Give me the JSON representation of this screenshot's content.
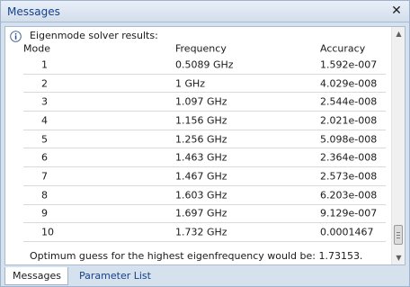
{
  "window": {
    "title": "Messages",
    "close_glyph": "✕"
  },
  "content": {
    "info_icon": "info-icon",
    "header": "Eigenmode solver results:",
    "columns": [
      "Mode",
      "Frequency",
      "Accuracy"
    ],
    "rows": [
      {
        "mode": "1",
        "frequency": "0.5089 GHz",
        "accuracy": "1.592e-007"
      },
      {
        "mode": "2",
        "frequency": "1 GHz",
        "accuracy": "4.029e-008"
      },
      {
        "mode": "3",
        "frequency": "1.097 GHz",
        "accuracy": "2.544e-008"
      },
      {
        "mode": "4",
        "frequency": "1.156 GHz",
        "accuracy": "2.021e-008"
      },
      {
        "mode": "5",
        "frequency": "1.256 GHz",
        "accuracy": "5.098e-008"
      },
      {
        "mode": "6",
        "frequency": "1.463 GHz",
        "accuracy": "2.364e-008"
      },
      {
        "mode": "7",
        "frequency": "1.467 GHz",
        "accuracy": "2.573e-008"
      },
      {
        "mode": "8",
        "frequency": "1.603 GHz",
        "accuracy": "6.203e-008"
      },
      {
        "mode": "9",
        "frequency": "1.697 GHz",
        "accuracy": "9.129e-007"
      },
      {
        "mode": "10",
        "frequency": "1.732 GHz",
        "accuracy": "0.0001467"
      }
    ],
    "footer": "Optimum guess for the highest eigenfrequency would be: 1.73153."
  },
  "scrollbar": {
    "up_glyph": "▲",
    "down_glyph": "▼"
  },
  "tabs": [
    {
      "label": "Messages",
      "active": true
    },
    {
      "label": "Parameter List",
      "active": false
    }
  ]
}
